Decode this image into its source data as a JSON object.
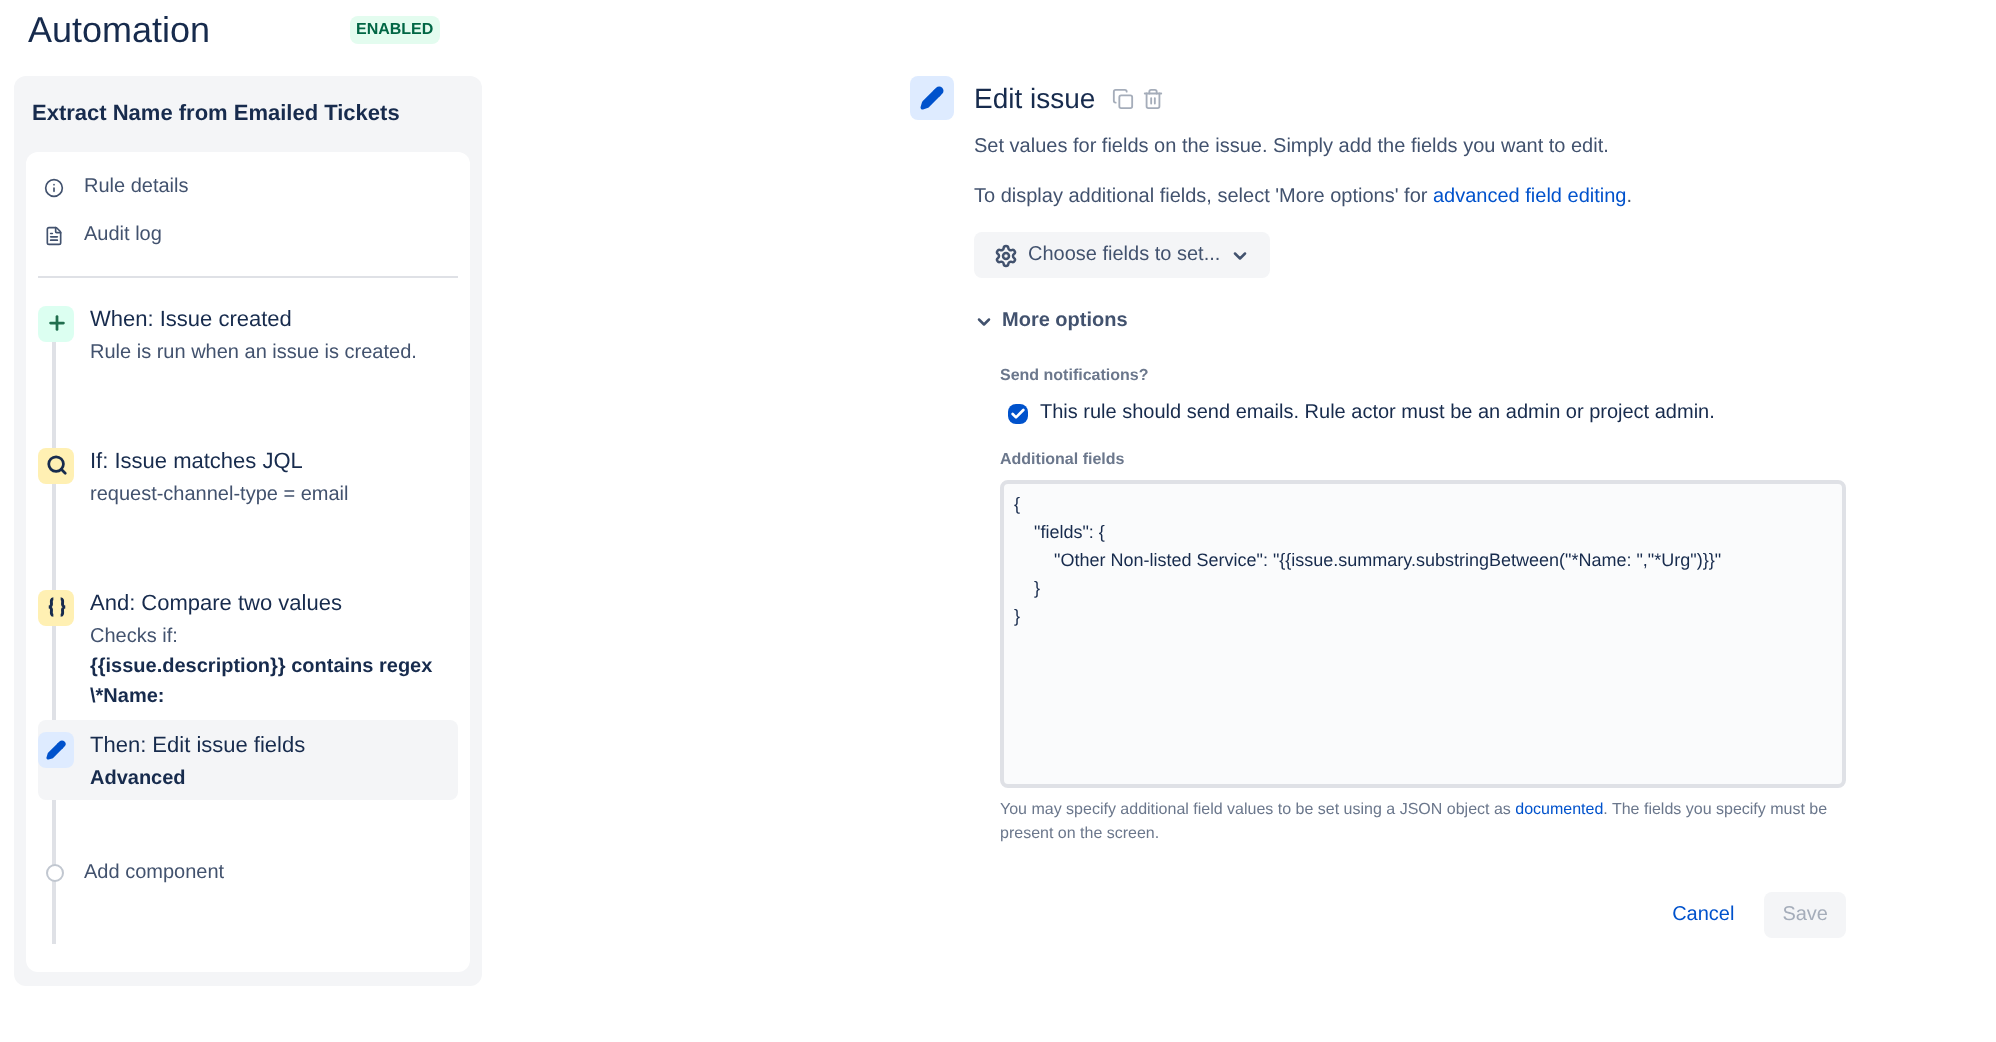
{
  "header": {
    "title": "Automation",
    "status": "ENABLED",
    "enabled": true
  },
  "rule": {
    "name": "Extract Name from Emailed Tickets",
    "menu": [
      {
        "kind": "info",
        "label": "Rule details"
      },
      {
        "kind": "log",
        "label": "Audit log"
      }
    ],
    "steps": [
      {
        "kind": "trigger",
        "title": "When: Issue created",
        "selected": false,
        "lines": [
          {
            "text": "Rule is run when an issue is created.",
            "bold": false
          }
        ]
      },
      {
        "kind": "condition",
        "title": "If: Issue matches JQL",
        "selected": false,
        "lines": [
          {
            "text": "request-channel-type = email",
            "bold": false
          }
        ]
      },
      {
        "kind": "compare",
        "title": "And: Compare two values",
        "selected": false,
        "lines": [
          {
            "text": "Checks if:",
            "bold": false
          },
          {
            "text": "{{issue.description}} contains regex \\*Name:",
            "bold": true
          }
        ]
      },
      {
        "kind": "action",
        "title": "Then: Edit issue fields",
        "selected": true,
        "lines": [
          {
            "text": "Advanced",
            "bold": true
          }
        ]
      }
    ],
    "add_label": "Add component"
  },
  "editor": {
    "title": "Edit issue",
    "intro": "Set values for fields on the issue. Simply add the fields you want to edit.",
    "more_text": {
      "before": "To display additional fields, select 'More options' for ",
      "link": "advanced field editing",
      "after": "."
    },
    "choose_button": "Choose fields to set...",
    "more_options": {
      "label": "More options",
      "expanded": true
    },
    "notifications": {
      "label": "Send notifications?",
      "checkbox_label": "This rule should send emails. Rule actor must be an admin or project admin.",
      "checked": true
    },
    "additional_fields": {
      "label": "Additional fields",
      "value": "{\n    \"fields\": {\n        \"Other Non-listed Service\": \"{{issue.summary.substringBetween(\"*Name: \",\"*Urg\")}}\"\n    }\n}"
    },
    "help": {
      "before": "You may specify additional field values to be set using a JSON object as ",
      "link": "documented",
      "after": ". The fields you specify must be present on the screen."
    },
    "buttons": [
      {
        "kind": "link",
        "label": "Cancel",
        "disabled": false
      },
      {
        "kind": "primary",
        "label": "Save",
        "disabled": true
      }
    ]
  }
}
